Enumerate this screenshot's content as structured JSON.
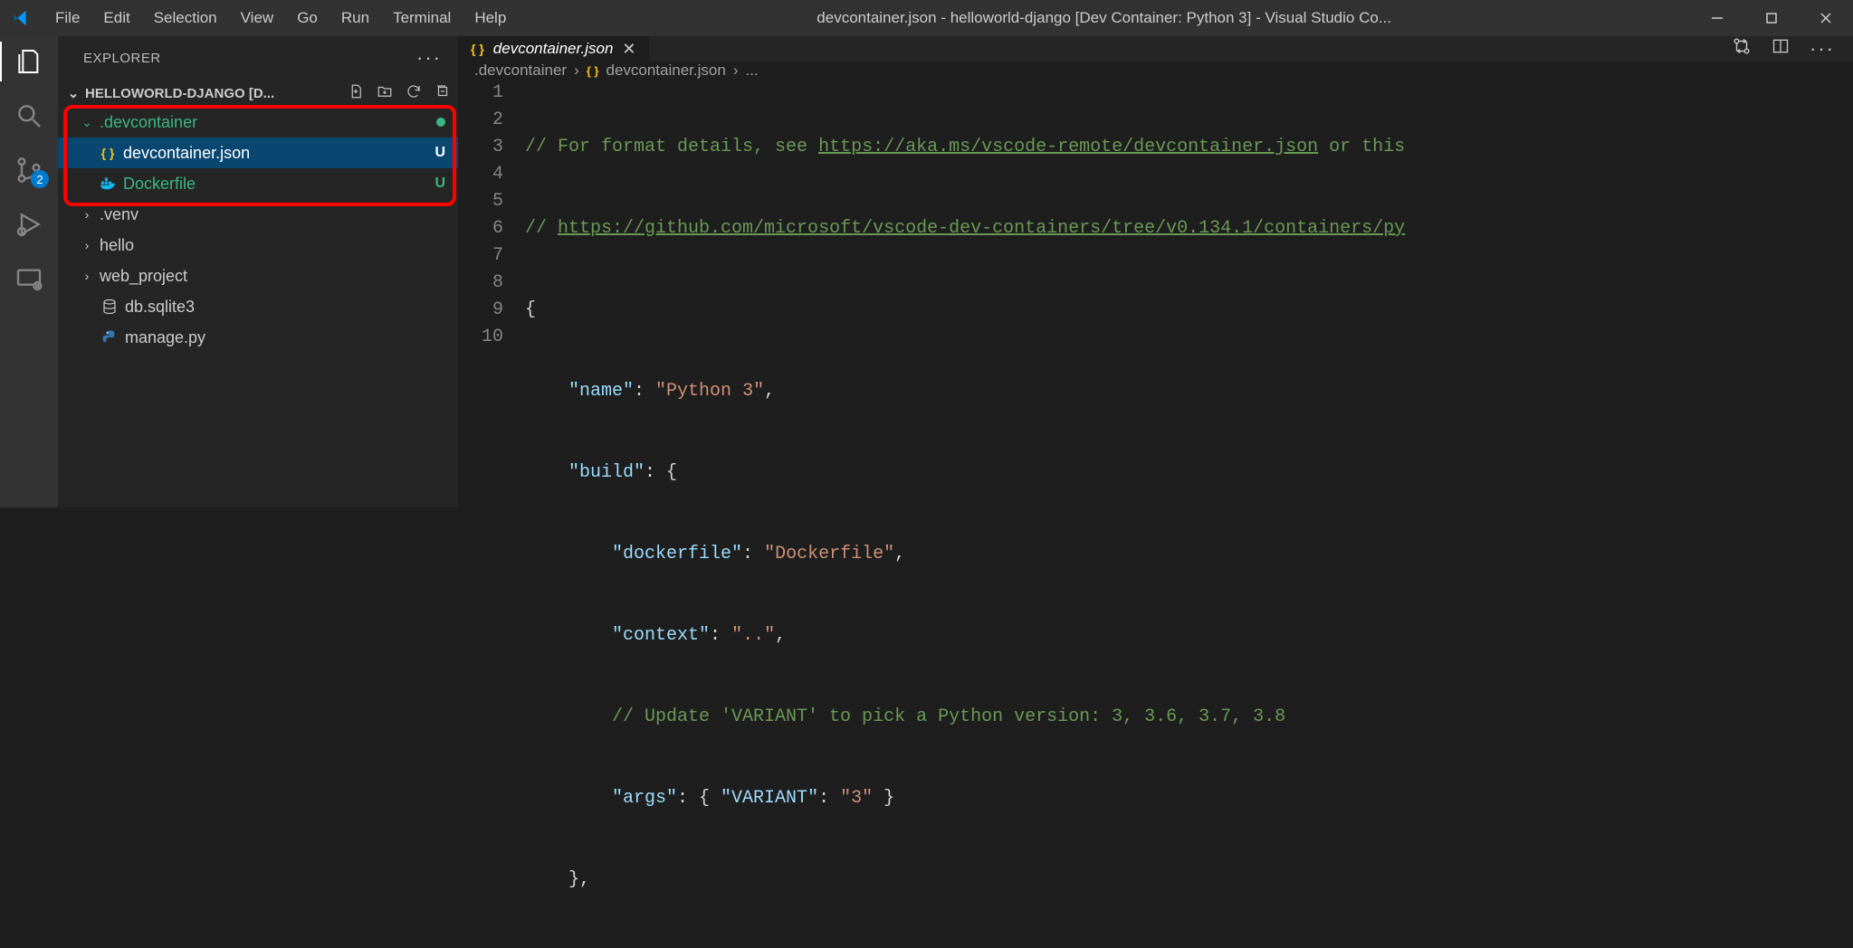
{
  "window": {
    "title": "devcontainer.json - helloworld-django [Dev Container: Python 3] - Visual Studio Co..."
  },
  "menu": {
    "items": [
      "File",
      "Edit",
      "Selection",
      "View",
      "Go",
      "Run",
      "Terminal",
      "Help"
    ]
  },
  "activity": {
    "scm_badge": "2"
  },
  "sidebar": {
    "title": "EXPLORER",
    "section": "HELLOWORLD-DJANGO [D...",
    "tree": [
      {
        "kind": "folder-open",
        "indent": 0,
        "twisty": "v",
        "label": ".devcontainer",
        "status": "dot"
      },
      {
        "kind": "file-selected",
        "indent": 1,
        "icon": "json",
        "label": "devcontainer.json",
        "status": "U"
      },
      {
        "kind": "file-mod",
        "indent": 1,
        "icon": "docker",
        "label": "Dockerfile",
        "status": "U"
      },
      {
        "kind": "folder",
        "indent": 0,
        "twisty": ">",
        "label": ".venv"
      },
      {
        "kind": "folder",
        "indent": 0,
        "twisty": ">",
        "label": "hello"
      },
      {
        "kind": "folder",
        "indent": 0,
        "twisty": ">",
        "label": "web_project"
      },
      {
        "kind": "file",
        "indent": 0,
        "icon": "db",
        "label": "db.sqlite3"
      },
      {
        "kind": "file",
        "indent": 0,
        "icon": "py",
        "label": "manage.py"
      }
    ]
  },
  "editor": {
    "tab_icon": "{ }",
    "tab_label": "devcontainer.json",
    "breadcrumbs": {
      "folder": ".devcontainer",
      "file": "devcontainer.json",
      "tail": "..."
    },
    "lines": [
      "1",
      "2",
      "3",
      "4",
      "5",
      "6",
      "7",
      "8",
      "9",
      "10"
    ],
    "code": {
      "l1_a": "// For format details, see ",
      "l1_link": "https://aka.ms/vscode-remote/devcontainer.json",
      "l1_b": " or this ",
      "l2_a": "// ",
      "l2_link": "https://github.com/microsoft/vscode-dev-containers/tree/v0.134.1/containers/py",
      "l3": "{",
      "l4_k": "\"name\"",
      "l4_v": "\"Python 3\"",
      "l5_k": "\"build\"",
      "l6_k": "\"dockerfile\"",
      "l6_v": "\"Dockerfile\"",
      "l7_k": "\"context\"",
      "l7_v": "\"..\"",
      "l8": "// Update 'VARIANT' to pick a Python version: 3, 3.6, 3.7, 3.8",
      "l9_k": "\"args\"",
      "l9_k2": "\"VARIANT\"",
      "l9_v": "\"3\"",
      "l10": "},"
    }
  }
}
